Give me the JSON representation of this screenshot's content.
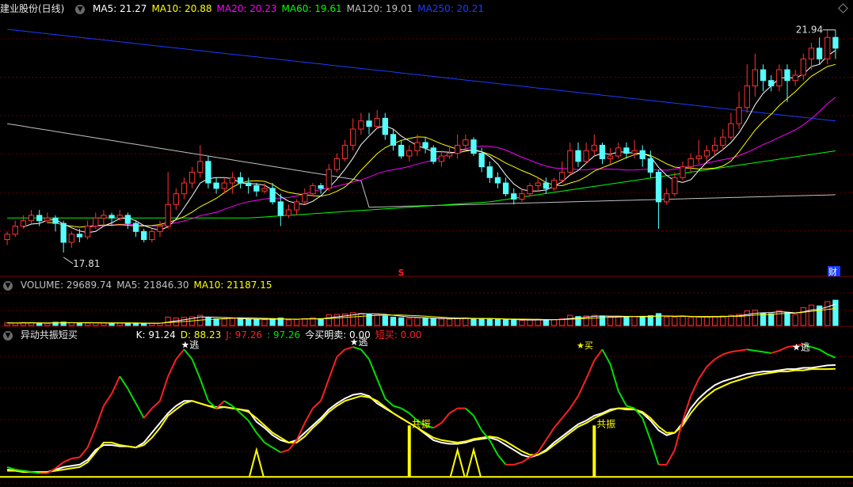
{
  "colors": {
    "up": "#ff3232",
    "down": "#54ffff",
    "ma5": "#ffffff",
    "ma10": "#ffff00",
    "ma20": "#ff00ff",
    "ma60": "#00ff00",
    "ma120": "#c0c0c0",
    "ma250": "#1a3cff",
    "k": "#ffffff",
    "d": "#ffff00",
    "j": "#ff2020",
    "j_low": "#00e000"
  },
  "price_panel": {
    "title": "建业股份(日线)",
    "ma": [
      {
        "label": "MA5: 21.27",
        "color": "#ffffff"
      },
      {
        "label": "MA10: 20.88",
        "color": "#ffff00"
      },
      {
        "label": "MA20: 20.23",
        "color": "#ff00ff"
      },
      {
        "label": "MA60: 19.61",
        "color": "#00ff00"
      },
      {
        "label": "MA120: 19.01",
        "color": "#c0c0c0"
      },
      {
        "label": "MA250: 20.21",
        "color": "#1a3cff"
      }
    ],
    "high_label": "21.94",
    "low_label": "17.81",
    "marker_s": "S",
    "marker_cai": "财"
  },
  "volume_panel": {
    "labels": [
      {
        "label": "VOLUME: 29689.74",
        "color": "#c0c0c0"
      },
      {
        "label": "MA5: 21846.30",
        "color": "#c0c0c0"
      },
      {
        "label": "MA10: 21187.15",
        "color": "#ffff00"
      }
    ]
  },
  "indicator_panel": {
    "title": "异动共振短买",
    "values": [
      {
        "label": "K: 91.24",
        "color": "#ffffff"
      },
      {
        "label": "D: 88.23",
        "color": "#ffff00"
      },
      {
        "label": "J: 97.26",
        "color": "#ff2020"
      },
      {
        "label": ": 97.26",
        "color": "#00e000"
      },
      {
        "label": "今买明卖: 0.00",
        "color": "#ffffff"
      },
      {
        "label": "短买: 0.00",
        "color": "#ff2020"
      }
    ],
    "escape_label": "★逃",
    "resonance_label": "共振",
    "buy_label": "★买"
  },
  "chart_data": {
    "type": "candlestick",
    "price_range": [
      17.5,
      22.2
    ],
    "candles": [
      [
        18.05,
        18.15,
        17.95,
        18.2
      ],
      [
        18.15,
        18.3,
        18.1,
        18.4
      ],
      [
        18.3,
        18.4,
        18.25,
        18.5
      ],
      [
        18.4,
        18.5,
        18.35,
        18.6
      ],
      [
        18.5,
        18.4,
        18.3,
        18.6
      ],
      [
        18.4,
        18.45,
        18.35,
        18.55
      ],
      [
        18.45,
        18.35,
        18.2,
        18.5
      ],
      [
        18.35,
        18.0,
        17.81,
        18.4
      ],
      [
        18.0,
        18.15,
        17.9,
        18.2
      ],
      [
        18.15,
        18.1,
        18.0,
        18.25
      ],
      [
        18.1,
        18.3,
        18.05,
        18.4
      ],
      [
        18.3,
        18.45,
        18.25,
        18.55
      ],
      [
        18.45,
        18.5,
        18.3,
        18.6
      ],
      [
        18.5,
        18.45,
        18.3,
        18.55
      ],
      [
        18.45,
        18.5,
        18.4,
        18.6
      ],
      [
        18.5,
        18.35,
        18.25,
        18.55
      ],
      [
        18.35,
        18.2,
        18.1,
        18.4
      ],
      [
        18.2,
        18.05,
        18.0,
        18.25
      ],
      [
        18.05,
        18.2,
        18.0,
        18.25
      ],
      [
        18.2,
        18.3,
        18.1,
        18.4
      ],
      [
        18.3,
        18.7,
        18.25,
        19.3
      ],
      [
        18.7,
        18.9,
        18.6,
        19.0
      ],
      [
        18.9,
        19.1,
        18.8,
        19.2
      ],
      [
        19.1,
        19.3,
        19.0,
        19.4
      ],
      [
        19.3,
        19.5,
        19.2,
        19.8
      ],
      [
        19.5,
        19.1,
        19.0,
        19.6
      ],
      [
        19.1,
        19.0,
        18.9,
        19.2
      ],
      [
        19.0,
        19.1,
        18.9,
        19.2
      ],
      [
        19.1,
        19.2,
        18.9,
        19.3
      ],
      [
        19.2,
        19.1,
        19.0,
        19.3
      ],
      [
        19.1,
        19.05,
        18.9,
        19.2
      ],
      [
        19.05,
        18.95,
        18.85,
        19.1
      ],
      [
        18.95,
        19.0,
        18.9,
        19.1
      ],
      [
        19.0,
        18.75,
        18.7,
        19.1
      ],
      [
        18.75,
        18.5,
        18.3,
        18.9
      ],
      [
        18.5,
        18.6,
        18.45,
        18.7
      ],
      [
        18.6,
        18.75,
        18.5,
        18.8
      ],
      [
        18.75,
        18.9,
        18.7,
        19.0
      ],
      [
        18.9,
        19.05,
        18.85,
        19.1
      ],
      [
        19.05,
        19.0,
        18.9,
        19.1
      ],
      [
        19.0,
        19.35,
        18.95,
        19.45
      ],
      [
        19.35,
        19.55,
        19.3,
        19.65
      ],
      [
        19.55,
        19.8,
        19.5,
        19.9
      ],
      [
        19.8,
        20.1,
        19.7,
        20.3
      ],
      [
        20.1,
        20.25,
        20.0,
        20.4
      ],
      [
        20.25,
        20.15,
        20.0,
        20.4
      ],
      [
        20.15,
        20.3,
        20.1,
        20.45
      ],
      [
        20.3,
        20.0,
        19.9,
        20.4
      ],
      [
        20.0,
        19.8,
        19.7,
        20.1
      ],
      [
        19.8,
        19.6,
        19.55,
        19.9
      ],
      [
        19.6,
        19.7,
        19.5,
        19.8
      ],
      [
        19.7,
        19.85,
        19.6,
        20.0
      ],
      [
        19.85,
        19.75,
        19.65,
        19.95
      ],
      [
        19.75,
        19.5,
        19.45,
        19.8
      ],
      [
        19.5,
        19.6,
        19.4,
        19.7
      ],
      [
        19.6,
        19.65,
        19.55,
        19.8
      ],
      [
        19.65,
        19.8,
        19.55,
        20.0
      ],
      [
        19.8,
        19.9,
        19.7,
        20.0
      ],
      [
        19.9,
        19.65,
        19.6,
        19.95
      ],
      [
        19.65,
        19.4,
        19.3,
        19.75
      ],
      [
        19.4,
        19.2,
        19.1,
        19.5
      ],
      [
        19.2,
        19.1,
        19.0,
        19.3
      ],
      [
        19.1,
        18.9,
        18.85,
        19.2
      ],
      [
        18.9,
        18.8,
        18.7,
        19.0
      ],
      [
        18.8,
        18.9,
        18.75,
        19.0
      ],
      [
        18.9,
        19.05,
        18.85,
        19.1
      ],
      [
        19.05,
        19.1,
        18.95,
        19.2
      ],
      [
        19.1,
        19.0,
        18.9,
        19.2
      ],
      [
        19.0,
        19.15,
        18.95,
        19.2
      ],
      [
        19.15,
        19.3,
        19.1,
        19.5
      ],
      [
        19.3,
        19.7,
        19.25,
        19.85
      ],
      [
        19.7,
        19.5,
        19.4,
        19.85
      ],
      [
        19.5,
        19.7,
        19.45,
        19.85
      ],
      [
        19.7,
        19.8,
        19.6,
        20.0
      ],
      [
        19.8,
        19.55,
        19.45,
        19.85
      ],
      [
        19.55,
        19.6,
        19.45,
        19.75
      ],
      [
        19.6,
        19.75,
        19.55,
        19.85
      ],
      [
        19.75,
        19.65,
        19.55,
        19.85
      ],
      [
        19.65,
        19.7,
        19.55,
        19.9
      ],
      [
        19.7,
        19.55,
        19.4,
        19.8
      ],
      [
        19.55,
        19.3,
        19.2,
        19.7
      ],
      [
        19.3,
        18.75,
        18.25,
        19.35
      ],
      [
        18.75,
        18.9,
        18.7,
        19.0
      ],
      [
        18.9,
        19.2,
        18.85,
        19.3
      ],
      [
        19.2,
        19.4,
        19.15,
        19.5
      ],
      [
        19.4,
        19.55,
        19.3,
        19.65
      ],
      [
        19.55,
        19.6,
        19.45,
        19.9
      ],
      [
        19.6,
        19.7,
        19.5,
        19.8
      ],
      [
        19.7,
        19.8,
        19.6,
        19.95
      ],
      [
        19.8,
        19.95,
        19.7,
        20.1
      ],
      [
        19.95,
        20.2,
        19.9,
        20.4
      ],
      [
        20.2,
        20.5,
        20.1,
        20.8
      ],
      [
        20.5,
        20.9,
        20.4,
        21.3
      ],
      [
        20.9,
        21.2,
        20.7,
        21.5
      ],
      [
        21.2,
        21.0,
        20.8,
        21.3
      ],
      [
        21.0,
        20.9,
        20.8,
        21.1
      ],
      [
        20.9,
        21.2,
        20.8,
        21.3
      ],
      [
        21.2,
        21.0,
        20.6,
        21.3
      ],
      [
        21.0,
        21.1,
        20.9,
        21.2
      ],
      [
        21.1,
        21.4,
        21.0,
        21.5
      ],
      [
        21.4,
        21.6,
        21.2,
        21.7
      ],
      [
        21.6,
        21.4,
        21.3,
        21.8
      ],
      [
        21.4,
        21.8,
        21.3,
        21.94
      ],
      [
        21.8,
        21.6,
        21.4,
        21.94
      ]
    ],
    "volume_range": [
      0,
      40000
    ],
    "volume": [
      3000,
      2800,
      3500,
      3200,
      2600,
      2400,
      3800,
      4000,
      3300,
      2900,
      2700,
      3100,
      3000,
      2800,
      2600,
      2700,
      2500,
      2400,
      2600,
      2800,
      9800,
      8700,
      9500,
      10200,
      12000,
      9000,
      7800,
      7500,
      8200,
      7900,
      7300,
      7000,
      6800,
      7700,
      8800,
      6500,
      7000,
      8000,
      9200,
      8100,
      12500,
      13000,
      13500,
      15000,
      14200,
      12800,
      12000,
      11000,
      9800,
      9000,
      8500,
      9100,
      8700,
      8000,
      7600,
      7300,
      8400,
      9000,
      8300,
      7900,
      7400,
      7000,
      6600,
      6200,
      6000,
      6500,
      7200,
      6800,
      7000,
      7800,
      12000,
      10500,
      11200,
      11900,
      10800,
      10200,
      10800,
      10000,
      10500,
      9800,
      11500,
      14000,
      10000,
      9800,
      10500,
      9400,
      10200,
      9900,
      10700,
      11000,
      12000,
      13000,
      17000,
      18000,
      14500,
      13800,
      17500,
      15000,
      13000,
      21000,
      24000,
      23000,
      28000,
      29689.74
    ],
    "kdj_range": [
      -5,
      110
    ],
    "k": [
      6,
      5,
      5,
      4,
      4,
      4,
      6,
      8,
      9,
      10,
      14,
      22,
      26,
      26,
      25,
      25,
      24,
      28,
      36,
      44,
      52,
      58,
      62,
      62,
      60,
      58,
      57,
      57,
      56,
      55,
      54,
      45,
      40,
      34,
      30,
      28,
      30,
      36,
      42,
      48,
      55,
      60,
      64,
      67,
      68,
      66,
      60,
      56,
      52,
      48,
      44,
      40,
      35,
      30,
      28,
      27,
      27,
      28,
      30,
      31,
      32,
      30,
      26,
      22,
      18,
      16,
      18,
      22,
      28,
      33,
      38,
      43,
      46,
      50,
      52,
      55,
      56,
      55,
      55,
      52,
      46,
      38,
      34,
      36,
      44,
      56,
      64,
      70,
      75,
      78,
      80,
      82,
      84,
      85,
      86,
      86,
      87,
      88,
      88,
      89,
      89,
      90,
      91,
      91.24
    ],
    "d": [
      5,
      5,
      4,
      4,
      4,
      4,
      5,
      6,
      7,
      8,
      12,
      20,
      28,
      28,
      26,
      25,
      24,
      26,
      32,
      40,
      50,
      55,
      60,
      62,
      60,
      58,
      56,
      57,
      56,
      55,
      53,
      48,
      42,
      36,
      32,
      28,
      28,
      33,
      40,
      46,
      53,
      58,
      62,
      64,
      66,
      65,
      62,
      57,
      52,
      48,
      44,
      40,
      36,
      32,
      30,
      29,
      28,
      29,
      31,
      32,
      33,
      32,
      29,
      25,
      21,
      18,
      18,
      21,
      26,
      31,
      36,
      41,
      44,
      48,
      51,
      54,
      56,
      56,
      55,
      53,
      48,
      41,
      36,
      36,
      42,
      52,
      60,
      66,
      71,
      74,
      77,
      79,
      81,
      83,
      84,
      85,
      86,
      86,
      87,
      87,
      88,
      88,
      88,
      88.23
    ],
    "j": [
      8,
      6,
      5,
      4,
      3,
      3,
      7,
      12,
      15,
      16,
      24,
      40,
      58,
      68,
      82,
      72,
      60,
      48,
      56,
      62,
      82,
      96,
      104,
      96,
      80,
      62,
      56,
      62,
      58,
      52,
      46,
      36,
      28,
      24,
      20,
      22,
      30,
      44,
      56,
      62,
      80,
      98,
      104,
      106,
      104,
      96,
      80,
      64,
      58,
      56,
      52,
      46,
      42,
      40,
      44,
      52,
      56,
      56,
      50,
      38,
      30,
      18,
      10,
      10,
      12,
      16,
      20,
      30,
      40,
      48,
      56,
      66,
      80,
      95,
      104,
      92,
      70,
      58,
      56,
      48,
      30,
      10,
      10,
      22,
      46,
      66,
      80,
      90,
      96,
      100,
      102,
      103,
      104,
      103,
      102,
      101,
      103,
      106,
      107,
      108,
      106,
      104,
      100,
      97.26
    ],
    "signals": {
      "escape_index": [
        22,
        43,
        98
      ],
      "resonance_index": [
        50,
        73
      ],
      "tri_index": [
        31,
        56,
        58
      ]
    }
  }
}
